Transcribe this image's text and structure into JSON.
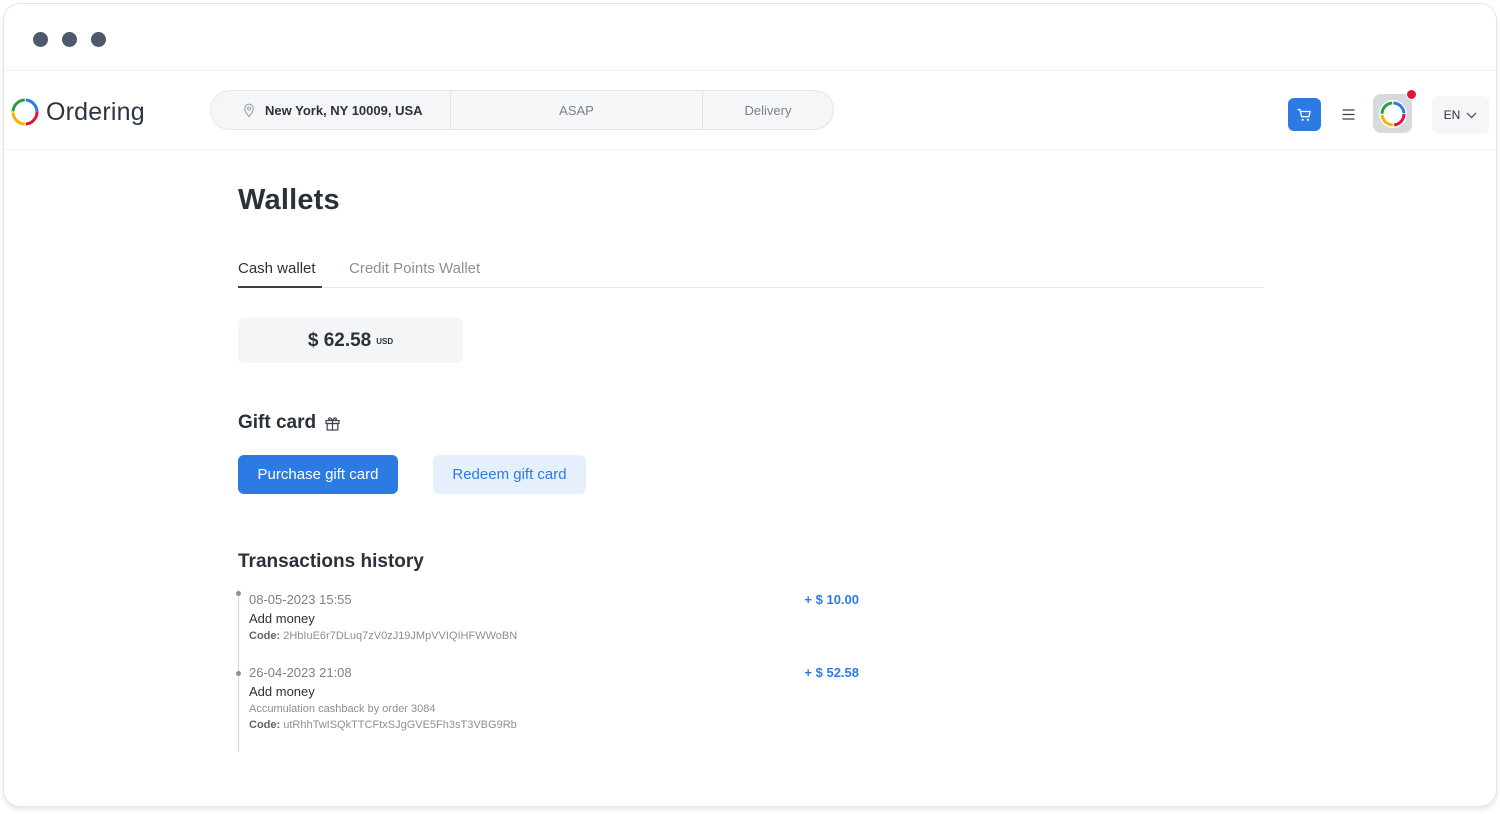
{
  "header": {
    "logo_text": "Ordering",
    "address": "New York, NY 10009, USA",
    "time": "ASAP",
    "order_type": "Delivery",
    "language": "EN"
  },
  "colors": {
    "primary": "#2c7be5",
    "primary_light": "#e6f0fc",
    "notification": "#e2143c",
    "text_dark": "#2b313a"
  },
  "icons": {
    "cart": "cart-icon",
    "menu": "hamburger-menu-icon",
    "location": "location-pin-icon",
    "gift": "gift-icon",
    "chevron": "chevron-down-icon"
  },
  "page": {
    "title": "Wallets",
    "tabs": [
      {
        "label": "Cash wallet",
        "active": true
      },
      {
        "label": "Credit Points Wallet",
        "active": false
      }
    ]
  },
  "balance": {
    "amount": "$ 62.58",
    "currency": "USD"
  },
  "gift_card": {
    "title": "Gift card",
    "purchase_label": "Purchase gift card",
    "redeem_label": "Redeem gift card"
  },
  "transactions": {
    "title": "Transactions history",
    "code_label": "Code:",
    "items": [
      {
        "date": "08-05-2023 15:55",
        "title": "Add money",
        "description": "",
        "code": "2HbIuE6r7DLuq7zV0zJ19JMpVVIQIHFWWoBN",
        "amount": "+ $ 10.00"
      },
      {
        "date": "26-04-2023 21:08",
        "title": "Add money",
        "description": "Accumulation cashback by order 3084",
        "code": "utRhhTwISQkTTCFtxSJgGVE5Fh3sT3VBG9Rb",
        "amount": "+ $ 52.58"
      }
    ]
  }
}
